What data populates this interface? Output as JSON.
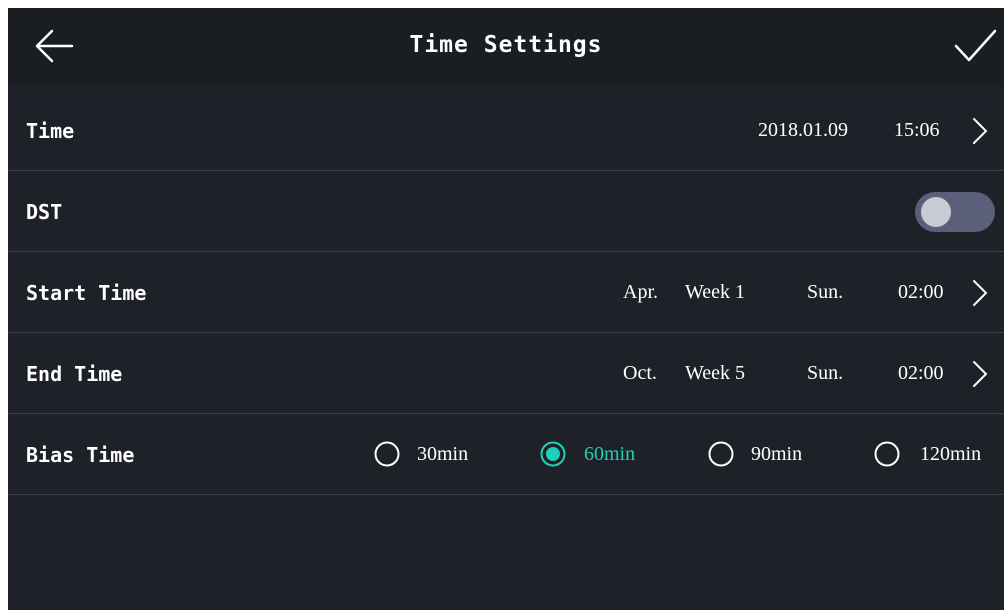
{
  "header": {
    "title": "Time Settings"
  },
  "icons": {
    "back": "back-arrow-icon",
    "confirm": "checkmark-icon",
    "chevron": "chevron-right-icon"
  },
  "rows": {
    "time": {
      "label": "Time",
      "date": "2018.01.09",
      "clock": "15:06"
    },
    "dst": {
      "label": "DST",
      "enabled": false
    },
    "start_time": {
      "label": "Start Time",
      "month": "Apr.",
      "week": "Week 1",
      "day": "Sun.",
      "time": "02:00"
    },
    "end_time": {
      "label": "End Time",
      "month": "Oct.",
      "week": "Week 5",
      "day": "Sun.",
      "time": "02:00"
    },
    "bias_time": {
      "label": "Bias Time",
      "selected": "60min",
      "options": [
        "30min",
        "60min",
        "90min",
        "120min"
      ]
    }
  },
  "colors": {
    "background": "#1e2228",
    "header": "#1a1d21",
    "accent": "#1fd0b6",
    "toggle_off_track": "#5c5f7a",
    "divider": "#3b4047"
  }
}
